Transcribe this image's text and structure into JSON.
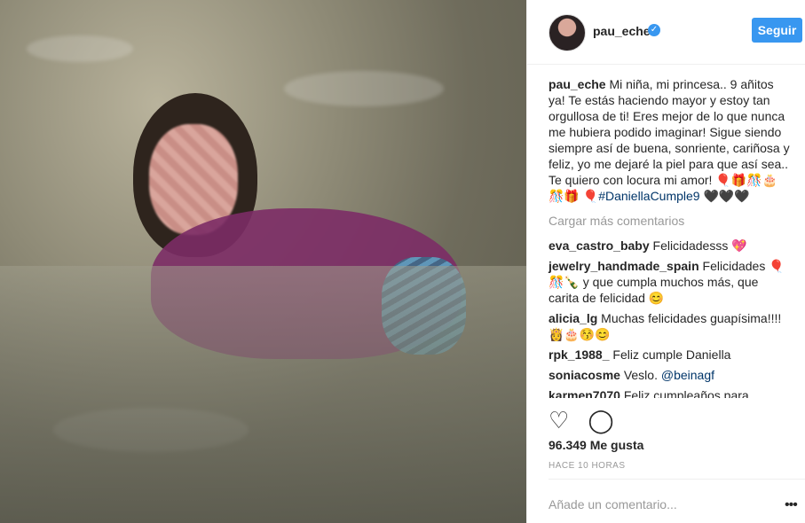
{
  "post": {
    "username": "pau_eche",
    "follow_label": "Seguir",
    "caption_user": "pau_eche",
    "caption_text": "Mi niña, mi princesa.. 9 añitos ya! Te estás haciendo mayor y estoy tan orgullosa de ti! Eres mejor de lo que nunca me hubiera podido imaginar! Sigue siendo siempre así de buena, sonriente, cariñosa y feliz, yo me dejaré la piel para que así sea.. Te quiero con locura mi amor! 🎈🎁🎊🎂🎊🎁",
    "caption_hashtag": "🎈#DaniellaCumple9",
    "caption_tail": " 🖤🖤🖤",
    "load_more": "Cargar más comentarios",
    "comments": [
      {
        "user": "eva_castro_baby",
        "text": "Felicidadesss 💖"
      },
      {
        "user": "jewelry_handmade_spain",
        "text": "Felicidades 🎈🎊🍾 y que cumpla muchos más, que carita de felicidad 😊"
      },
      {
        "user": "alicia_lg",
        "text": "Muchas felicidades guapísima!!!!👸🎂😚😊"
      },
      {
        "user": "rpk_1988_",
        "text": "Feliz cumple Daniella"
      },
      {
        "user": "soniacosme",
        "text": "Veslo. ",
        "mention": "@beinagf"
      },
      {
        "user": "karmen7070",
        "text": "Feliz cumpleaños para Daniela"
      }
    ],
    "likes": "96.349 Me gusta",
    "time": "HACE 10 HORAS",
    "add_comment_placeholder": "Añade un comentario...",
    "more_icon": "•••"
  },
  "icons": {
    "heart": "heart-icon",
    "comment": "comment-icon",
    "verified": "verified-badge-icon"
  }
}
